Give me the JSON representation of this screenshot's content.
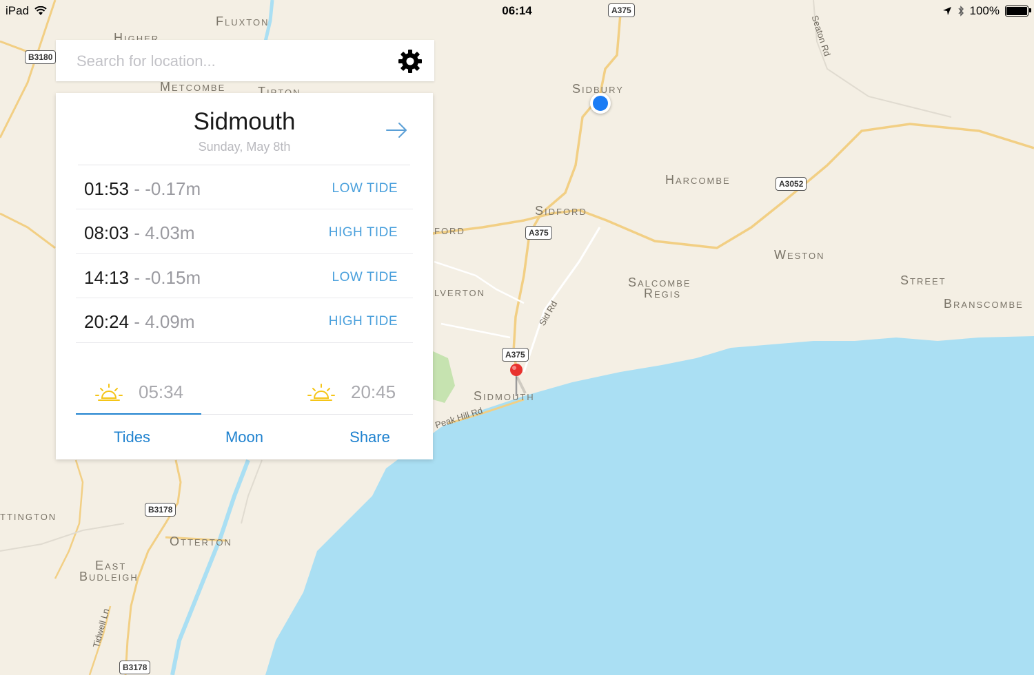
{
  "status_bar": {
    "device": "iPad",
    "time": "06:14",
    "battery": "100%",
    "icons": [
      "wifi-icon",
      "location-arrow-icon",
      "bluetooth-icon",
      "battery-icon"
    ]
  },
  "map": {
    "labels": {
      "fluxton": "Fluxton",
      "higher": "Higher",
      "metcombe": "Metcombe",
      "tipton": "Tipton",
      "sidbury": "Sidbury",
      "harcombe": "Harcombe",
      "sidford": "Sidford",
      "weston": "Weston",
      "salcombe_regis_1": "Salcombe",
      "salcombe_regis_2": "Regis",
      "street": "Street",
      "branscombe": "Branscombe",
      "ford": "ford",
      "lverton": "lverton",
      "sidmouth": "Sidmouth",
      "ttington": "ttington",
      "otterton": "Otterton",
      "east_budleigh_1": "East",
      "east_budleigh_2": "Budleigh"
    },
    "road_signs": {
      "b3180": "B3180",
      "a375_top": "A375",
      "a3052": "A3052",
      "a375_mid": "A375",
      "a375_low": "A375",
      "b3178_mid": "B3178",
      "b3178_bottom": "B3178"
    },
    "road_names": {
      "seaton_rd": "Seaton Rd",
      "sid_rd": "Sid Rd",
      "peak_hill_rd": "Peak Hill Rd",
      "tidwell_ln": "Tidwell Ln"
    },
    "colors": {
      "land": "#f4efe4",
      "sea": "#aadff3",
      "road": "#f2cf84",
      "river": "#aadff3",
      "user_dot": "#1a7cf5",
      "pin": "#e8322e"
    }
  },
  "search": {
    "placeholder": "Search for location...",
    "value": ""
  },
  "tide_card": {
    "location": "Sidmouth",
    "date": "Sunday, May 8th",
    "tides": [
      {
        "time": "01:53",
        "height": "-0.17m",
        "type": "LOW TIDE"
      },
      {
        "time": "08:03",
        "height": "4.03m",
        "type": "HIGH TIDE"
      },
      {
        "time": "14:13",
        "height": "-0.15m",
        "type": "LOW TIDE"
      },
      {
        "time": "20:24",
        "height": "4.09m",
        "type": "HIGH TIDE"
      }
    ],
    "sunrise": "05:34",
    "sunset": "20:45",
    "tabs": [
      "Tides",
      "Moon",
      "Share"
    ],
    "active_tab": "Tides",
    "accent_color": "#1f82cf"
  }
}
